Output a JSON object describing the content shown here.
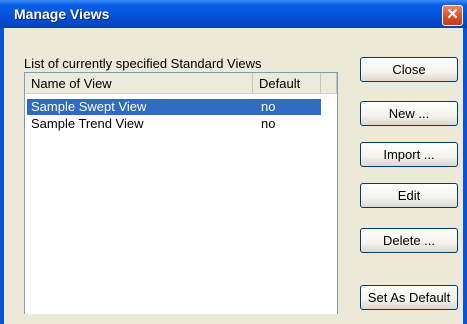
{
  "window": {
    "title": "Manage Views",
    "close_glyph": "✕"
  },
  "caption": "List of currently specified Standard Views",
  "list": {
    "columns": [
      "Name of View",
      "Default"
    ],
    "rows": [
      {
        "name": "Sample Swept View",
        "default": "no",
        "selected": true
      },
      {
        "name": "Sample Trend View",
        "default": "no",
        "selected": false
      }
    ]
  },
  "buttons": {
    "close": "Close",
    "new": "New ...",
    "import": "Import ...",
    "edit": "Edit",
    "delete": "Delete ...",
    "set_default": "Set As Default"
  },
  "colors": {
    "titlebar": "#0453DA",
    "selection": "#316AC5",
    "dialog_bg": "#ECE9D8",
    "close_button": "#D9532F"
  }
}
